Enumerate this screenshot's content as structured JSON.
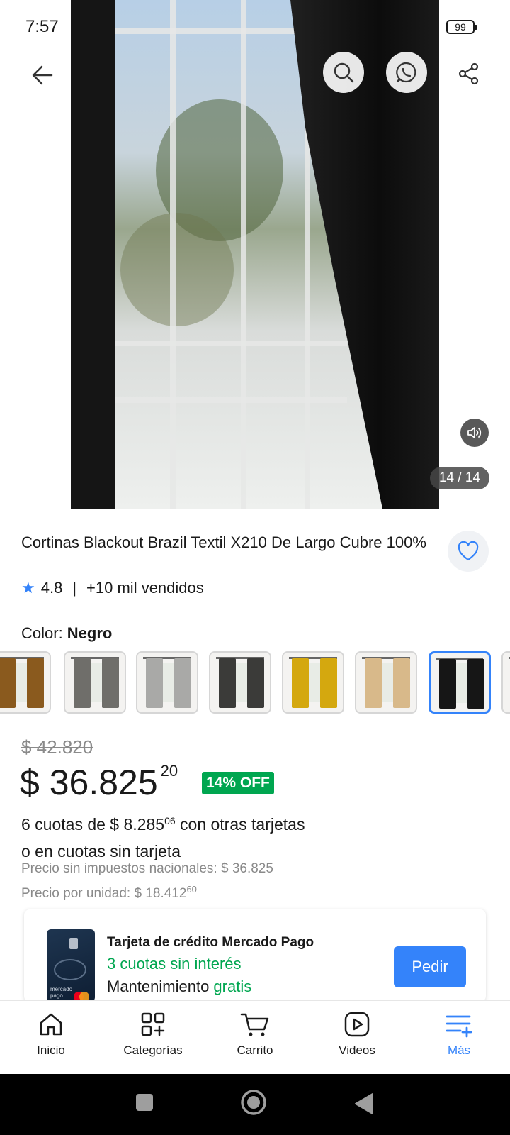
{
  "status_bar": {
    "time": "7:57",
    "battery": "99"
  },
  "media": {
    "counter": "14 / 14"
  },
  "product": {
    "title": "Cortinas Blackout Brazil Textil X210 De Largo Cubre 100%",
    "rating": "4.8",
    "sold": "+10 mil vendidos",
    "color_label": "Color: ",
    "color_value": "Negro",
    "swatches": [
      {
        "name": "marron",
        "color": "#8a5a1e"
      },
      {
        "name": "gris-oscuro",
        "color": "#6f6e6a"
      },
      {
        "name": "gris-claro",
        "color": "#a9a9a7"
      },
      {
        "name": "negro-gris",
        "color": "#3b3b39"
      },
      {
        "name": "amarillo",
        "color": "#d4a80f"
      },
      {
        "name": "beige",
        "color": "#d8b98a"
      },
      {
        "name": "negro",
        "color": "#161616"
      },
      {
        "name": "extra",
        "color": "#e0e0e0"
      }
    ],
    "selected_swatch": 6
  },
  "pricing": {
    "old_price": "$ 42.820",
    "price_main": "$ 36.825",
    "price_cents": "20",
    "discount": "14% OFF",
    "installments_prefix": "6 cuotas de $ 8.285",
    "installments_cents": "06",
    "installments_suffix": " con otras tarjetas",
    "installments_line2": "o en cuotas sin tarjeta",
    "tax_line": "Precio sin impuestos nacionales: $ 36.825",
    "unit_price_prefix": "Precio por unidad: $ 18.412",
    "unit_price_cents": "60"
  },
  "promo": {
    "title": "Tarjeta de crédito Mercado Pago",
    "offer": "3 cuotas sin interés",
    "maint_prefix": "Mantenimiento ",
    "maint_free": "gratis",
    "button": "Pedir",
    "card_brand": "mercado pago"
  },
  "bottom_nav": [
    {
      "label": "Inicio",
      "icon": "home-icon"
    },
    {
      "label": "Categorías",
      "icon": "categories-icon"
    },
    {
      "label": "Carrito",
      "icon": "cart-icon"
    },
    {
      "label": "Videos",
      "icon": "video-icon"
    },
    {
      "label": "Más",
      "icon": "menu-plus-icon"
    }
  ],
  "colors": {
    "accent": "#3483fa",
    "success": "#00a650",
    "muted": "#8a8a8a"
  }
}
